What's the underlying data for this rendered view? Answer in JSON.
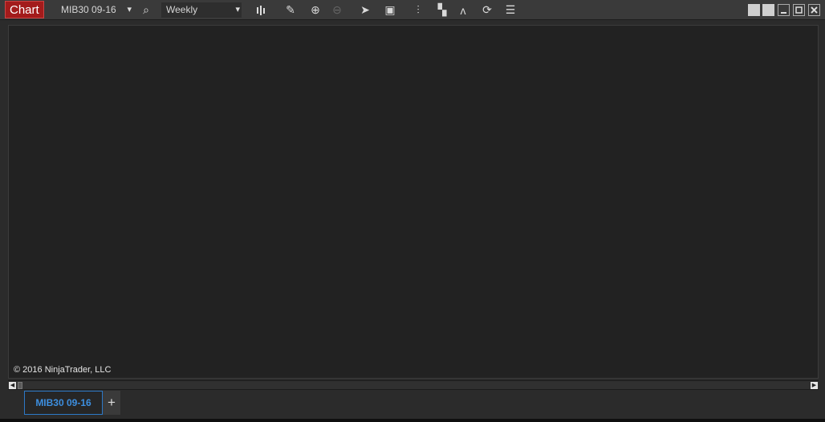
{
  "window": {
    "title": "Chart",
    "instrument": "MIB30 09-16",
    "interval": "Weekly"
  },
  "toolbar": {
    "icons": [
      "search-icon",
      "bars-type-icon",
      "pencil-icon",
      "zoom-in-icon",
      "zoom-out-icon",
      "pointer-icon",
      "data-box-icon",
      "price-levels-icon",
      "strategy-icon",
      "indicator-icon",
      "refresh-icon",
      "properties-icon"
    ]
  },
  "chart": {
    "copyright": "© 2016 NinjaTrader, LLC"
  },
  "tabs": [
    {
      "label": "MIB30 09-16",
      "active": true
    }
  ],
  "add_tab_label": "+",
  "colors": {
    "accent": "#a31b1b",
    "tab_accent": "#2d79c7",
    "chart_bg": "#222222"
  }
}
